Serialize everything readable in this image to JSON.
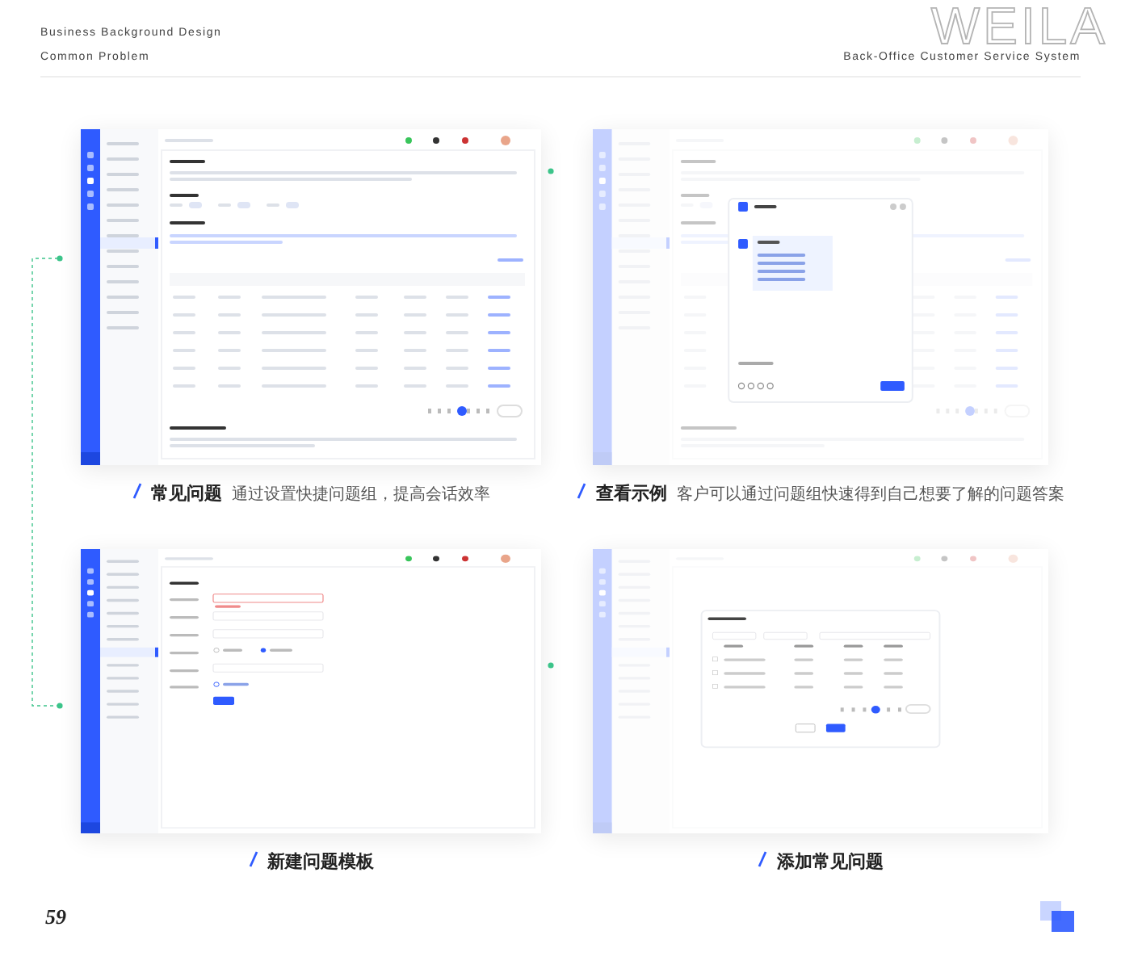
{
  "header": {
    "watermark_title": "WEILA",
    "subtitle": "Business Background Design",
    "section": "Common Problem",
    "system": "Back-Office Customer Service System"
  },
  "panels": [
    {
      "kind": "list",
      "title": "常见问题",
      "description": "通过设置快捷问题组，提高会话效率"
    },
    {
      "kind": "chat",
      "title": "查看示例",
      "description": "客户可以通过问题组快速得到自己想要了解的问题答案"
    },
    {
      "kind": "form",
      "title": "新建问题模板"
    },
    {
      "kind": "dialog",
      "title": "添加常见问题"
    }
  ],
  "footer": {
    "page_number": "59"
  }
}
